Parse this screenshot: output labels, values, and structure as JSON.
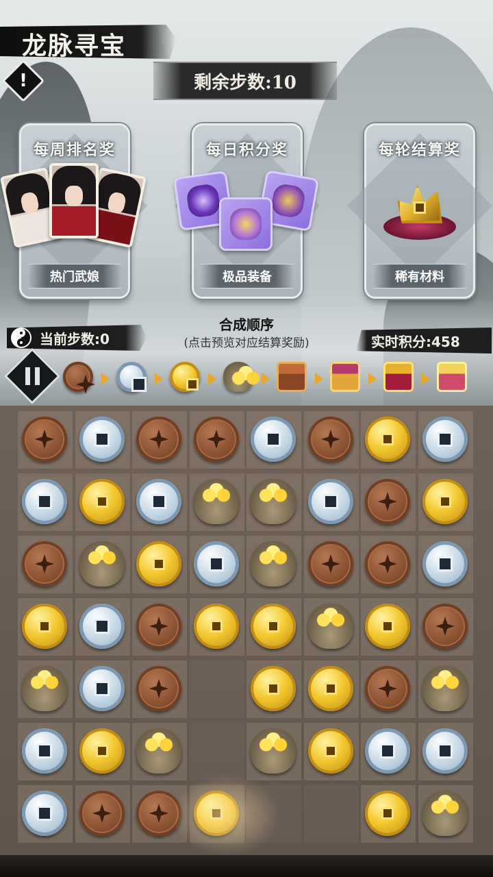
{
  "header": {
    "title": "龙脉寻宝",
    "remaining_steps": "剩余步数:10"
  },
  "reward_cards": [
    {
      "category": "每周排名奖",
      "name": "热门武娘"
    },
    {
      "category": "每日积分奖",
      "name": "极品装备"
    },
    {
      "category": "每轮结算奖",
      "name": "稀有材料"
    }
  ],
  "status": {
    "current_steps": "当前步数:0",
    "combine_title": "合成顺序",
    "combine_hint": "(点击预览对应结算奖励)",
    "score": "实时积分:458"
  },
  "combine_order": [
    "bronze-coin-icon",
    "silver-coin-icon",
    "gold-coin-icon",
    "gold-ingot-bag-icon",
    "wooden-chest-icon",
    "ornate-chest-icon",
    "red-gold-chest-icon",
    "golden-chest-icon"
  ],
  "board": {
    "columns": 8,
    "rows": [
      [
        "bronze",
        "silver",
        "bronze",
        "bronze",
        "silver",
        "bronze",
        "gold",
        "silver"
      ],
      [
        "silver",
        "gold",
        "silver",
        "bag",
        "bag",
        "silver",
        "bronze",
        "gold"
      ],
      [
        "bronze",
        "bag",
        "gold",
        "silver",
        "bag",
        "bronze",
        "bronze",
        "silver"
      ],
      [
        "gold",
        "silver",
        "bronze",
        "gold",
        "gold",
        "bag",
        "gold",
        "bronze"
      ],
      [
        "bag",
        "silver",
        "bronze",
        "",
        "gold",
        "gold",
        "bronze",
        "bag"
      ],
      [
        "silver",
        "gold",
        "bag",
        "",
        "bag",
        "gold",
        "silver",
        "silver"
      ],
      [
        "silver",
        "bronze",
        "bronze",
        "gold",
        "",
        "",
        "gold",
        "bag"
      ]
    ]
  },
  "colors": {
    "accent_arrow": "#e5a72c",
    "board_bg": "#5f544b"
  }
}
